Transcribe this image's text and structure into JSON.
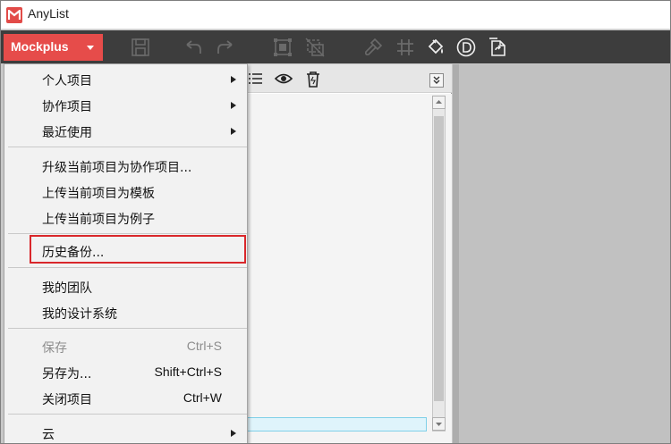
{
  "window": {
    "title": "AnyList"
  },
  "toolbar": {
    "brand_label": "Mockplus",
    "icons": [
      "save-icon",
      "undo-icon",
      "redo-icon",
      "group-icon",
      "ungroup-icon",
      "format-painter-icon",
      "grid-icon",
      "fill-icon",
      "d-circle-icon",
      "export-page-icon"
    ]
  },
  "menu": {
    "items": [
      {
        "label": "个人项目",
        "submenu": true
      },
      {
        "label": "协作项目",
        "submenu": true
      },
      {
        "label": "最近使用",
        "submenu": true
      },
      {
        "label": "升级当前项目为协作项目..."
      },
      {
        "label": "上传当前项目为模板"
      },
      {
        "label": "上传当前项目为例子"
      },
      {
        "label": "历史备份..."
      },
      {
        "label": "我的团队"
      },
      {
        "label": "我的设计系统"
      },
      {
        "label": "保存",
        "shortcut": "Ctrl+S",
        "disabled": true
      },
      {
        "label": "另存为...",
        "shortcut": "Shift+Ctrl+S"
      },
      {
        "label": "关闭项目",
        "shortcut": "Ctrl+W"
      },
      {
        "label": "云",
        "submenu": true
      }
    ]
  },
  "colors": {
    "brand": "#e64c4a",
    "toolbar": "#3d3d3d",
    "highlight": "#d9272b"
  }
}
